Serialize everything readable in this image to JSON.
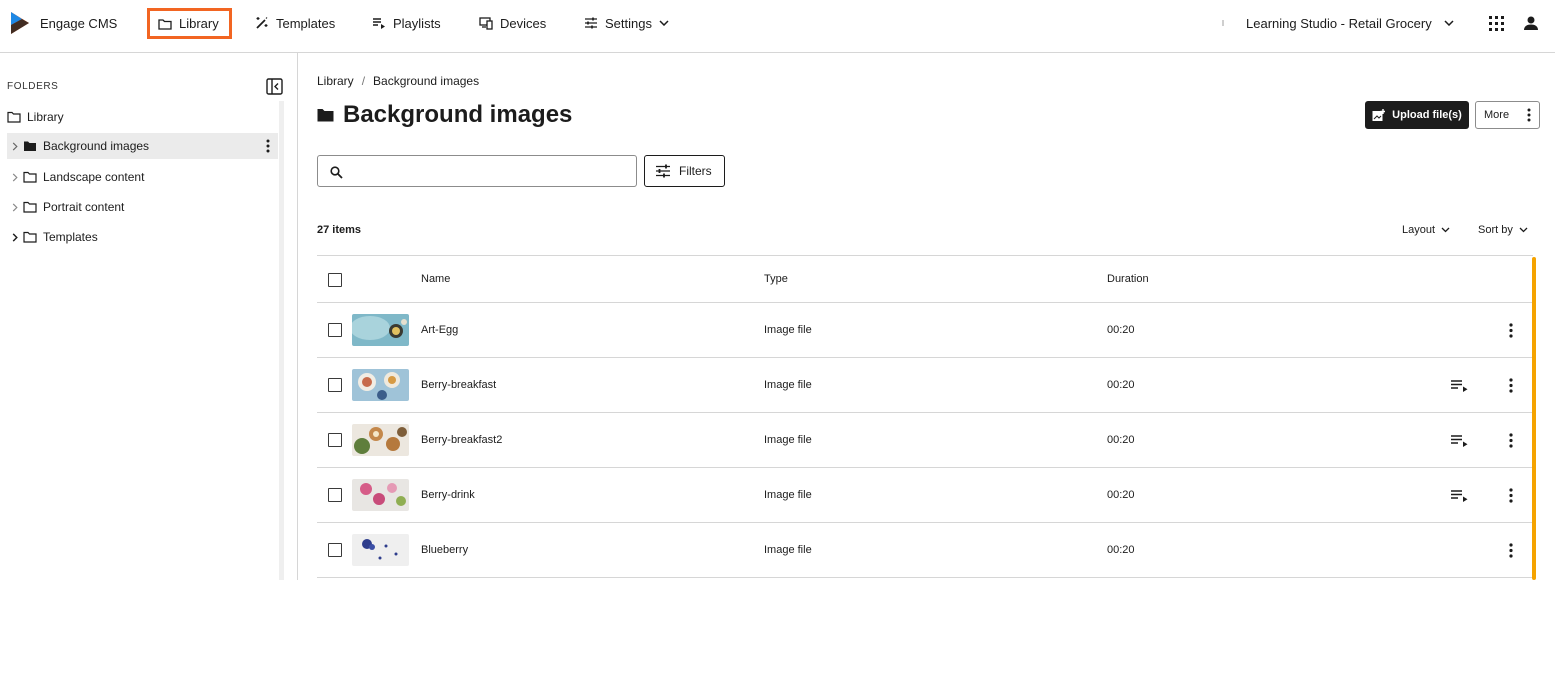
{
  "header": {
    "brand": "Engage CMS",
    "nav": [
      {
        "label": "Library",
        "icon": "folder-icon"
      },
      {
        "label": "Templates",
        "icon": "magic-wand-icon"
      },
      {
        "label": "Playlists",
        "icon": "playlist-icon"
      },
      {
        "label": "Devices",
        "icon": "devices-icon"
      },
      {
        "label": "Settings",
        "icon": "sliders-icon"
      }
    ],
    "workspace": "Learning Studio - Retail Grocery",
    "accent_color": "#f26522"
  },
  "sidebar": {
    "title": "FOLDERS",
    "items": [
      {
        "label": "Library"
      },
      {
        "label": "Background images"
      },
      {
        "label": "Landscape content"
      },
      {
        "label": "Portrait content"
      },
      {
        "label": "Templates"
      }
    ]
  },
  "main": {
    "breadcrumb": [
      "Library",
      "/",
      "Background images"
    ],
    "title": "Background images",
    "upload_label": "Upload file(s)",
    "more_label": "More",
    "search_placeholder": "",
    "filters_label": "Filters",
    "items_count": "27 items",
    "layout_label": "Layout",
    "sort_label": "Sort by",
    "columns": [
      "Name",
      "Type",
      "Duration"
    ],
    "rows": [
      {
        "name": "Art-Egg",
        "type": "Image file",
        "duration": "00:20",
        "in_playlist": false
      },
      {
        "name": "Berry-breakfast",
        "type": "Image file",
        "duration": "00:20",
        "in_playlist": true
      },
      {
        "name": "Berry-breakfast2",
        "type": "Image file",
        "duration": "00:20",
        "in_playlist": true
      },
      {
        "name": "Berry-drink",
        "type": "Image file",
        "duration": "00:20",
        "in_playlist": true
      },
      {
        "name": "Blueberry",
        "type": "Image file",
        "duration": "00:20",
        "in_playlist": false
      }
    ],
    "scroll_color": "#f5a300"
  }
}
